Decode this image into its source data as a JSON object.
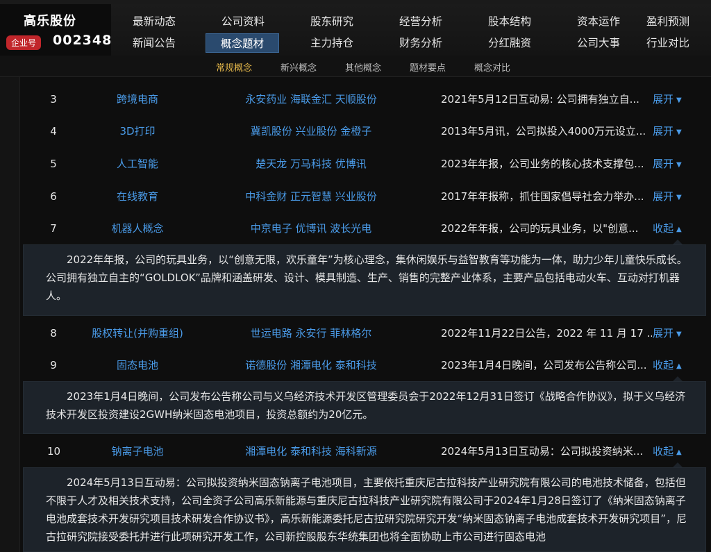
{
  "company": {
    "name": "高乐股份",
    "badge": "企业号",
    "code": "002348"
  },
  "nav": {
    "row1": [
      "最新动态",
      "公司资料",
      "股东研究",
      "经营分析",
      "股本结构",
      "资本运作",
      "盈利预测"
    ],
    "row2": [
      "新闻公告",
      "概念题材",
      "主力持仓",
      "财务分析",
      "分红融资",
      "公司大事",
      "行业对比"
    ],
    "active": "概念题材"
  },
  "subnav": {
    "items": [
      "常规概念",
      "新兴概念",
      "其他概念",
      "题材要点",
      "概念对比"
    ],
    "active": "常规概念"
  },
  "rows": [
    {
      "num": "3",
      "concept": "跨境电商",
      "stocks": "永安药业 海联金汇 天顺股份",
      "desc": "2021年5月12日互动易: 公司拥有独立自...",
      "toggle": "展开",
      "arrow": "▼"
    },
    {
      "num": "4",
      "concept": "3D打印",
      "stocks": "冀凯股份 兴业股份 金橙子",
      "desc": "2013年5月讯，公司拟投入4000万元设立...",
      "toggle": "展开",
      "arrow": "▼"
    },
    {
      "num": "5",
      "concept": "人工智能",
      "stocks": "楚天龙 万马科技 优博讯",
      "desc": "2023年年报，公司业务的核心技术支撑包...",
      "toggle": "展开",
      "arrow": "▼"
    },
    {
      "num": "6",
      "concept": "在线教育",
      "stocks": "中科金财 正元智慧 兴业股份",
      "desc": "2017年年报称，抓住国家倡导社会力举办...",
      "toggle": "展开",
      "arrow": "▼"
    },
    {
      "num": "7",
      "concept": "机器人概念",
      "stocks": "中京电子 优博讯 波长光电",
      "desc": "2022年年报，公司的玩具业务，以\"创意...",
      "toggle": "收起",
      "arrow": "▲"
    },
    {
      "num": "8",
      "concept": "股权转让(并购重组)",
      "stocks": "世运电路 永安行 菲林格尔",
      "desc": "2022年11月22日公告，2022 年 11 月 17 ...",
      "toggle": "展开",
      "arrow": "▼"
    },
    {
      "num": "9",
      "concept": "固态电池",
      "stocks": "诺德股份 湘潭电化 泰和科技",
      "desc": "2023年1月4日晚间，公司发布公告称公司...",
      "toggle": "收起",
      "arrow": "▲"
    },
    {
      "num": "10",
      "concept": "钠离子电池",
      "stocks": "湘潭电化 泰和科技 海科新源",
      "desc": "2024年5月13日互动易：公司拟投资纳米...",
      "toggle": "收起",
      "arrow": "▲"
    }
  ],
  "details": {
    "robot": "2022年年报，公司的玩具业务，以“创意无限，欢乐童年”为核心理念，集休闲娱乐与益智教育等功能为一体，助力少年儿童快乐成长。公司拥有独立自主的“GOLDLOK”品牌和涵盖研发、设计、模具制造、生产、销售的完整产业体系，主要产品包括电动火车、互动对打机器人。",
    "solid": "2023年1月4日晚间，公司发布公告称公司与义乌经济技术开发区管理委员会于2022年12月31日签订《战略合作协议》，拟于义乌经济技术开发区投资建设2GWH纳米固态电池项目，投资总额约为20亿元。",
    "sodium": "2024年5月13日互动易：公司拟投资纳米固态钠离子电池项目，主要依托重庆尼古拉科技产业研究院有限公司的电池技术储备，包括但不限于人才及相关技术支持，公司全资子公司高乐新能源与重庆尼古拉科技产业研究院有限公司于2024年1月28日签订了《纳米固态钠离子电池成套技术开发研究项目技术研发合作协议书》，高乐新能源委托尼古拉研究院研究开发“纳米固态钠离子电池成套技术开发研究项目”，尼古拉研究院接受委托并进行此项研究开发工作，公司新控股股东华统集团也将全面协助上市公司进行固态电池"
  }
}
